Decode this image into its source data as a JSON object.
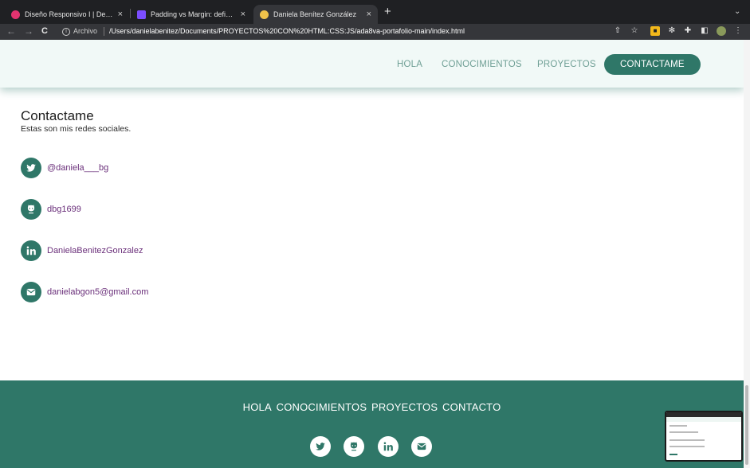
{
  "browser": {
    "tabs": [
      {
        "title": "Diseño Responsivo I | Desarroll",
        "favicon_color": "#e3336f",
        "active": false
      },
      {
        "title": "Padding vs Margin: definición,",
        "favicon_color": "#7b4dff",
        "active": false
      },
      {
        "title": "Daniela Benítez González",
        "favicon_color": "#f0c24a",
        "active": true
      }
    ],
    "close_glyph": "×",
    "new_tab_glyph": "+",
    "tab_menu_glyph": "⌄",
    "back_glyph": "←",
    "forward_glyph": "→",
    "reload_glyph": "C",
    "info_glyph": "i",
    "security_label": "Archivo",
    "url": "/Users/danielabenitez/Documents/PROYECTOS%20CON%20HTML:CSS:JS/ada8va-portafolio-main/index.html",
    "right_icons": [
      "share-icon",
      "bookmark-star-icon",
      "extension-icon",
      "react-devtools-icon",
      "puzzle-icon",
      "sidepanel-icon",
      "profile-avatar"
    ],
    "more_glyph": "⋮"
  },
  "header": {
    "nav": [
      "HOLA",
      "CONOCIMIENTOS",
      "PROYECTOS",
      "CONTACTAME"
    ]
  },
  "contact": {
    "title": "Contactame",
    "subtitle": "Estas son mis redes sociales.",
    "links": [
      {
        "icon": "twitter-icon",
        "label": "@daniela___bg"
      },
      {
        "icon": "github-icon",
        "label": "dbg1699"
      },
      {
        "icon": "linkedin-icon",
        "label": "DanielaBenitezGonzalez"
      },
      {
        "icon": "email-icon",
        "label": "danielabgon5@gmail.com"
      }
    ]
  },
  "footer": {
    "links": [
      "HOLA",
      "CONOCIMIENTOS",
      "PROYECTOS",
      "CONTACTO"
    ],
    "icons": [
      "twitter-icon",
      "github-icon",
      "linkedin-icon",
      "email-icon"
    ]
  },
  "colors": {
    "accent": "#2f7768",
    "link": "#6a2f7a",
    "header_bg": "#f1f9f7"
  }
}
